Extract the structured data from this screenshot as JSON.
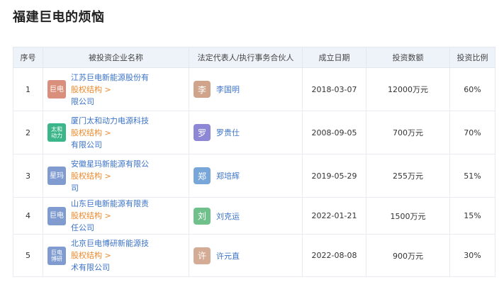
{
  "page_title": "福建巨电的烦恼",
  "headers": [
    "序号",
    "被投资企业名称",
    "法定代表人/执行事务合伙人",
    "成立日期",
    "投资数额",
    "投资比例"
  ],
  "rows": [
    {
      "no": "1",
      "logo": "巨电",
      "logo_color": "#d98f7c",
      "name_a": "江苏巨电新能源股份有",
      "name_b": "限公司",
      "equity": "股权结构 >",
      "avatar": "李",
      "avatar_color": "#cfa48a",
      "person": "李国明",
      "date": "2018-03-07",
      "amount": "12000万元",
      "ratio": "60%"
    },
    {
      "no": "2",
      "logo": "太和\n动力",
      "logo_color": "#3bb58a",
      "name_a": "厦门太和动力电源科技",
      "name_b": "有限公司",
      "equity": "股权结构 >",
      "avatar": "罗",
      "avatar_color": "#8d87d6",
      "person": "罗贵仕",
      "date": "2008-09-05",
      "amount": "700万元",
      "ratio": "70%"
    },
    {
      "no": "3",
      "logo": "星玛",
      "logo_color": "#7f9bd0",
      "name_a": "安徽星玛新能源有限公",
      "name_b": "司",
      "equity": "股权结构 >",
      "avatar": "郑",
      "avatar_color": "#77a6d8",
      "person": "郑培辉",
      "date": "2019-05-29",
      "amount": "255万元",
      "ratio": "51%"
    },
    {
      "no": "4",
      "logo": "巨电",
      "logo_color": "#7f9bd0",
      "name_a": "山东巨电新能源有限责",
      "name_b": "任公司",
      "equity": "股权结构 >",
      "avatar": "刘",
      "avatar_color": "#6fc08a",
      "person": "刘克运",
      "date": "2022-01-21",
      "amount": "1500万元",
      "ratio": "15%"
    },
    {
      "no": "5",
      "logo": "巨电\n博研",
      "logo_color": "#7f9bd0",
      "name_a": "北京巨电博研新能源技",
      "name_b": "术有限公司",
      "equity": "股权结构 >",
      "avatar": "许",
      "avatar_color": "#d4ab94",
      "person": "许元直",
      "date": "2022-08-08",
      "amount": "900万元",
      "ratio": "30%"
    }
  ]
}
